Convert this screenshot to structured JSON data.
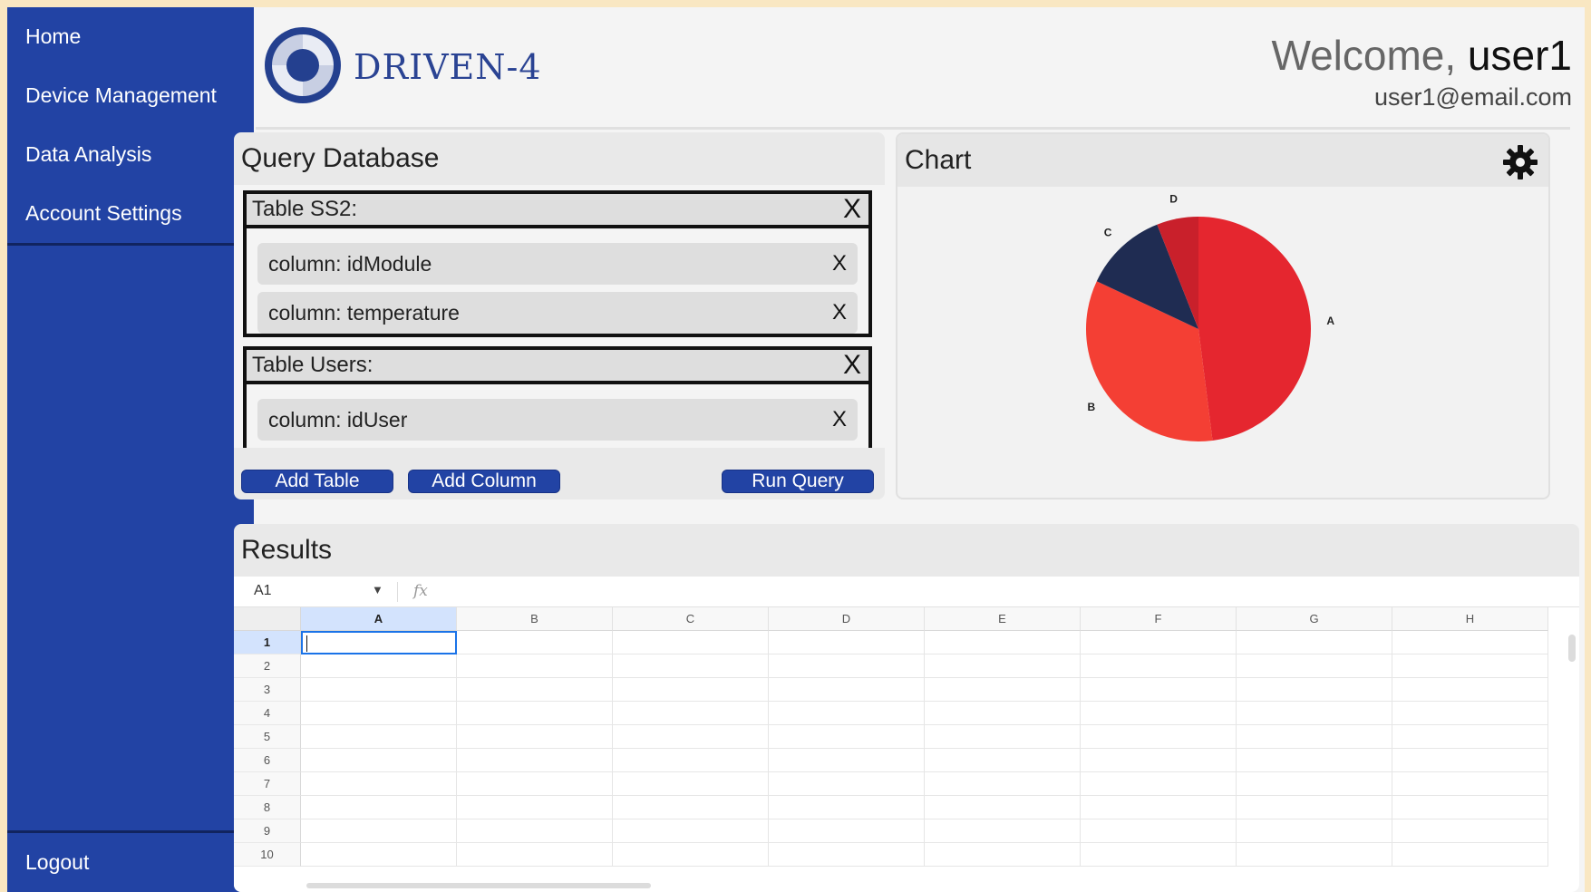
{
  "sidebar": {
    "items": [
      {
        "label": "Home"
      },
      {
        "label": "Device Management"
      },
      {
        "label": "Data Analysis"
      },
      {
        "label": "Account Settings"
      }
    ],
    "logout": "Logout"
  },
  "header": {
    "brand": "DRIVEN-4",
    "welcome_prefix": "Welcome,",
    "username": "user1",
    "email": "user1@email.com"
  },
  "query": {
    "title": "Query Database",
    "tables": [
      {
        "name": "Table SS2:",
        "columns": [
          "column: idModule",
          "column: temperature"
        ]
      },
      {
        "name": "Table Users:",
        "columns": [
          "column: idUser"
        ]
      }
    ],
    "remove_label": "X",
    "buttons": {
      "add_table": "Add Table",
      "add_column": "Add Column",
      "run_query": "Run Query"
    }
  },
  "chart": {
    "title": "Chart",
    "settings_icon": "gear-icon",
    "colors": {
      "A": "#e5262f",
      "B": "#f43f34",
      "C": "#1f2c52",
      "D": "#c9202b"
    }
  },
  "chart_data": {
    "type": "pie",
    "categories": [
      "A",
      "B",
      "C",
      "D"
    ],
    "values": [
      48,
      34,
      12,
      6
    ],
    "title": ""
  },
  "results": {
    "title": "Results",
    "name_box": "A1",
    "fx_label": "fx",
    "columns": [
      "A",
      "B",
      "C",
      "D",
      "E",
      "F",
      "G",
      "H"
    ],
    "rows": [
      "1",
      "2",
      "3",
      "4",
      "5",
      "6",
      "7",
      "8",
      "9",
      "10"
    ],
    "active_cell": "A1"
  },
  "theme": {
    "accent": "#2243a4",
    "sidebar_border": "#11245f"
  }
}
